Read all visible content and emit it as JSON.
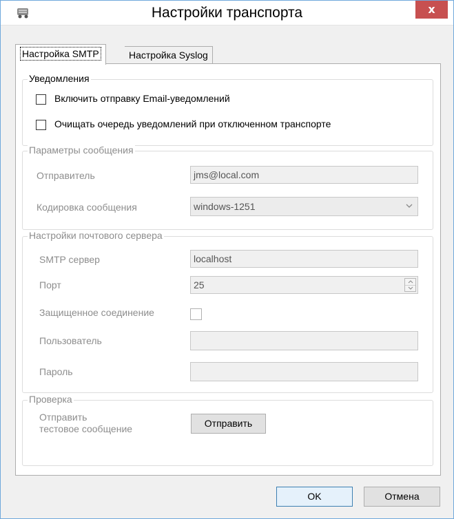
{
  "window": {
    "title": "Настройки транспорта",
    "close_glyph": "x"
  },
  "tabs": [
    {
      "label": "Настройка SMTP",
      "active": true
    },
    {
      "label": "Настройка Syslog",
      "active": false
    }
  ],
  "notifications": {
    "group_title": "Уведомления",
    "enable_email_label": "Включить отправку Email-уведомлений",
    "clear_queue_label": "Очищать очередь уведомлений при отключенном транспорте"
  },
  "message_params": {
    "group_title": "Параметры сообщения",
    "sender_label": "Отправитель",
    "sender_value": "jms@local.com",
    "encoding_label": "Кодировка сообщения",
    "encoding_value": "windows-1251"
  },
  "mail_server": {
    "group_title": "Настройки почтового сервера",
    "smtp_label": "SMTP сервер",
    "smtp_value": "localhost",
    "port_label": "Порт",
    "port_value": "25",
    "secure_label": "Защищенное соединение",
    "user_label": "Пользователь",
    "user_value": "",
    "password_label": "Пароль",
    "password_value": ""
  },
  "check": {
    "group_title": "Проверка",
    "send_test_line1": "Отправить",
    "send_test_line2": "тестовое сообщение",
    "send_button": "Отправить"
  },
  "footer": {
    "ok": "OK",
    "cancel": "Отмена"
  },
  "icons": {
    "app": "transport-icon",
    "close": "close-icon",
    "dropdown": "chevron-down-icon",
    "spin_up": "chevron-up-icon",
    "spin_down": "chevron-down-icon"
  }
}
